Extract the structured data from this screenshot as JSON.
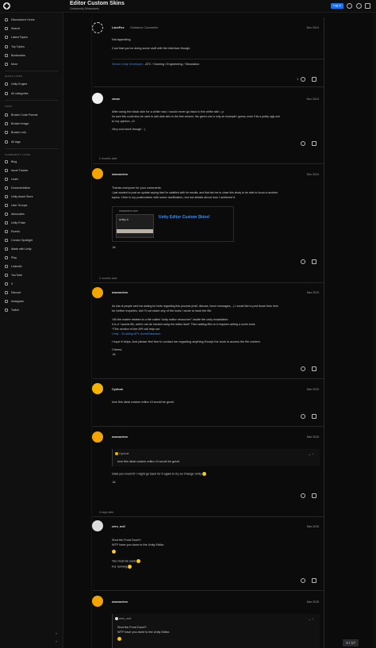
{
  "header": {
    "title": "Editor Custom Skins",
    "category": "Community Showcases",
    "login_label": "Log In"
  },
  "sidebar": {
    "items": [
      {
        "label": "Discussions Home"
      },
      {
        "label": "Search"
      },
      {
        "label": "Latest Topics"
      },
      {
        "label": "Top Topics"
      },
      {
        "label": "Bookmarks"
      },
      {
        "label": "More"
      }
    ],
    "quick_links_heading": "QUICK LINKS",
    "quick_links": [
      {
        "label": "Unity Engine"
      },
      {
        "label": "All categories"
      }
    ],
    "tags_heading": "TAGS",
    "tags": [
      {
        "label": "Broken Code Format"
      },
      {
        "label": "Broken Image"
      },
      {
        "label": "Broken Link"
      },
      {
        "label": "All tags"
      }
    ],
    "community_heading": "COMMUNITY LINKS",
    "community": [
      {
        "label": "Blog"
      },
      {
        "label": "Issue Tracker"
      },
      {
        "label": "Learn"
      },
      {
        "label": "Documentation"
      },
      {
        "label": "Unity Asset Store"
      },
      {
        "label": "User Groups"
      },
      {
        "label": "Advocates"
      },
      {
        "label": "Unity Pulse"
      },
      {
        "label": "Events"
      },
      {
        "label": "Creator Spotlight"
      },
      {
        "label": "Made with Unity"
      },
      {
        "label": "Play"
      },
      {
        "label": "LinkedIn"
      },
      {
        "label": "YouTube"
      },
      {
        "label": "X"
      },
      {
        "label": "Discord"
      },
      {
        "label": "Instagram"
      },
      {
        "label": "Twitch"
      }
    ]
  },
  "posts": {
    "lane": {
      "user": "LaneFox",
      "title": "Guidance Counsellor",
      "date": "Nov 2014",
      "line1": "Not appealing.",
      "line2": "Cool that you've doing some stuff with the interface though.",
      "signature_link": "Senior Unity Developer",
      "signature_rest": " - ATC / Gaming / Engineering / Simulation",
      "likes": "1"
    },
    "vimar": {
      "user": "vimar",
      "date": "Nov 2014",
      "line1": "After using the black skin for a while now, i would never go back to the white skin ; p",
      "line2": "Im sure this could also be used to add dark skin to the free version, the green one is only an example i guess, even if its a pretty ugly one",
      "line3": "to my opinion ;-D",
      "line4": "Very cool work though : )"
    },
    "gap1": "2 months later",
    "mam1": {
      "user": "mamoniem",
      "date": "Dec 2014",
      "line1": "Thanks everyone for your comments.",
      "line2": "I just wanted to post an update saying that I'm satisfied with he results, and that led me to close this study to be able to focus in another",
      "line3": "topics. Here is my postmortem with some clarification, but not details about how I achieved it.",
      "onebox_site": "mamoniem.com",
      "onebox_title": "Unity Editor Custom Skins!",
      "onebox_img_text": "unity 4",
      "sign": "-M."
    },
    "gap2": "2 months later",
    "mam2": {
      "user": "mamoniem",
      "date": "Mar 2015",
      "line1": "As lots of people sent me asking for hints regarding this process (mail, discuss, forum messages,...) I would like to post those hints here",
      "line2": "for further inquiries, but I'll not share any of the tools I wrote to hack the file.",
      "line3": "*All the matter related to a file called \"unity editor resources\" inside the unity installation.",
      "line4": "It is a *.assets file, which can be hacked using the editor itself. Then adding files to it requires writing a some tools.",
      "line5": "*This section of the API will help out",
      "line6": "Unity - Scripting API: AssetDatabase",
      "line7": "I hope it helps, And please feel free to contact me regarding anything Except the tools to access the file content.",
      "line8": "Cheers,",
      "sign": "-M."
    },
    "cyn": {
      "user": "Cynicat",
      "date": "Mar 2015",
      "line1": "love this ideal custom editor UI would be great."
    },
    "mam3": {
      "user": "mamoniem",
      "date": "Mar 2015",
      "quote_user": "Cynicat:",
      "quote_text": "love this ideal custom editor UI would be great.",
      "line1": "Glad you loved it! I might go back for it again to try an Orange Unity",
      "sign": "-M."
    },
    "gap3": "6 days later",
    "zero": {
      "user": "zero_null",
      "date": "Mar 2015",
      "line1": "Shut the Front Door!!!",
      "line2": "WTF have you done to the Unity Editor.",
      "line3": "You must be sued",
      "line4": "For running"
    },
    "mam4": {
      "user": "mamoniem",
      "date": "Mar 2015",
      "quote_user": "zero_null:",
      "quote_l1": "Shut the Front Door!!!",
      "quote_l2": "WTF have you done to the Unity Editor."
    }
  },
  "progress": {
    "current": "8",
    "total": "/ 17"
  },
  "icons": [
    "unity-logo-icon",
    "search-icon",
    "menu-icon",
    "heart-icon",
    "link-icon",
    "share-icon"
  ]
}
